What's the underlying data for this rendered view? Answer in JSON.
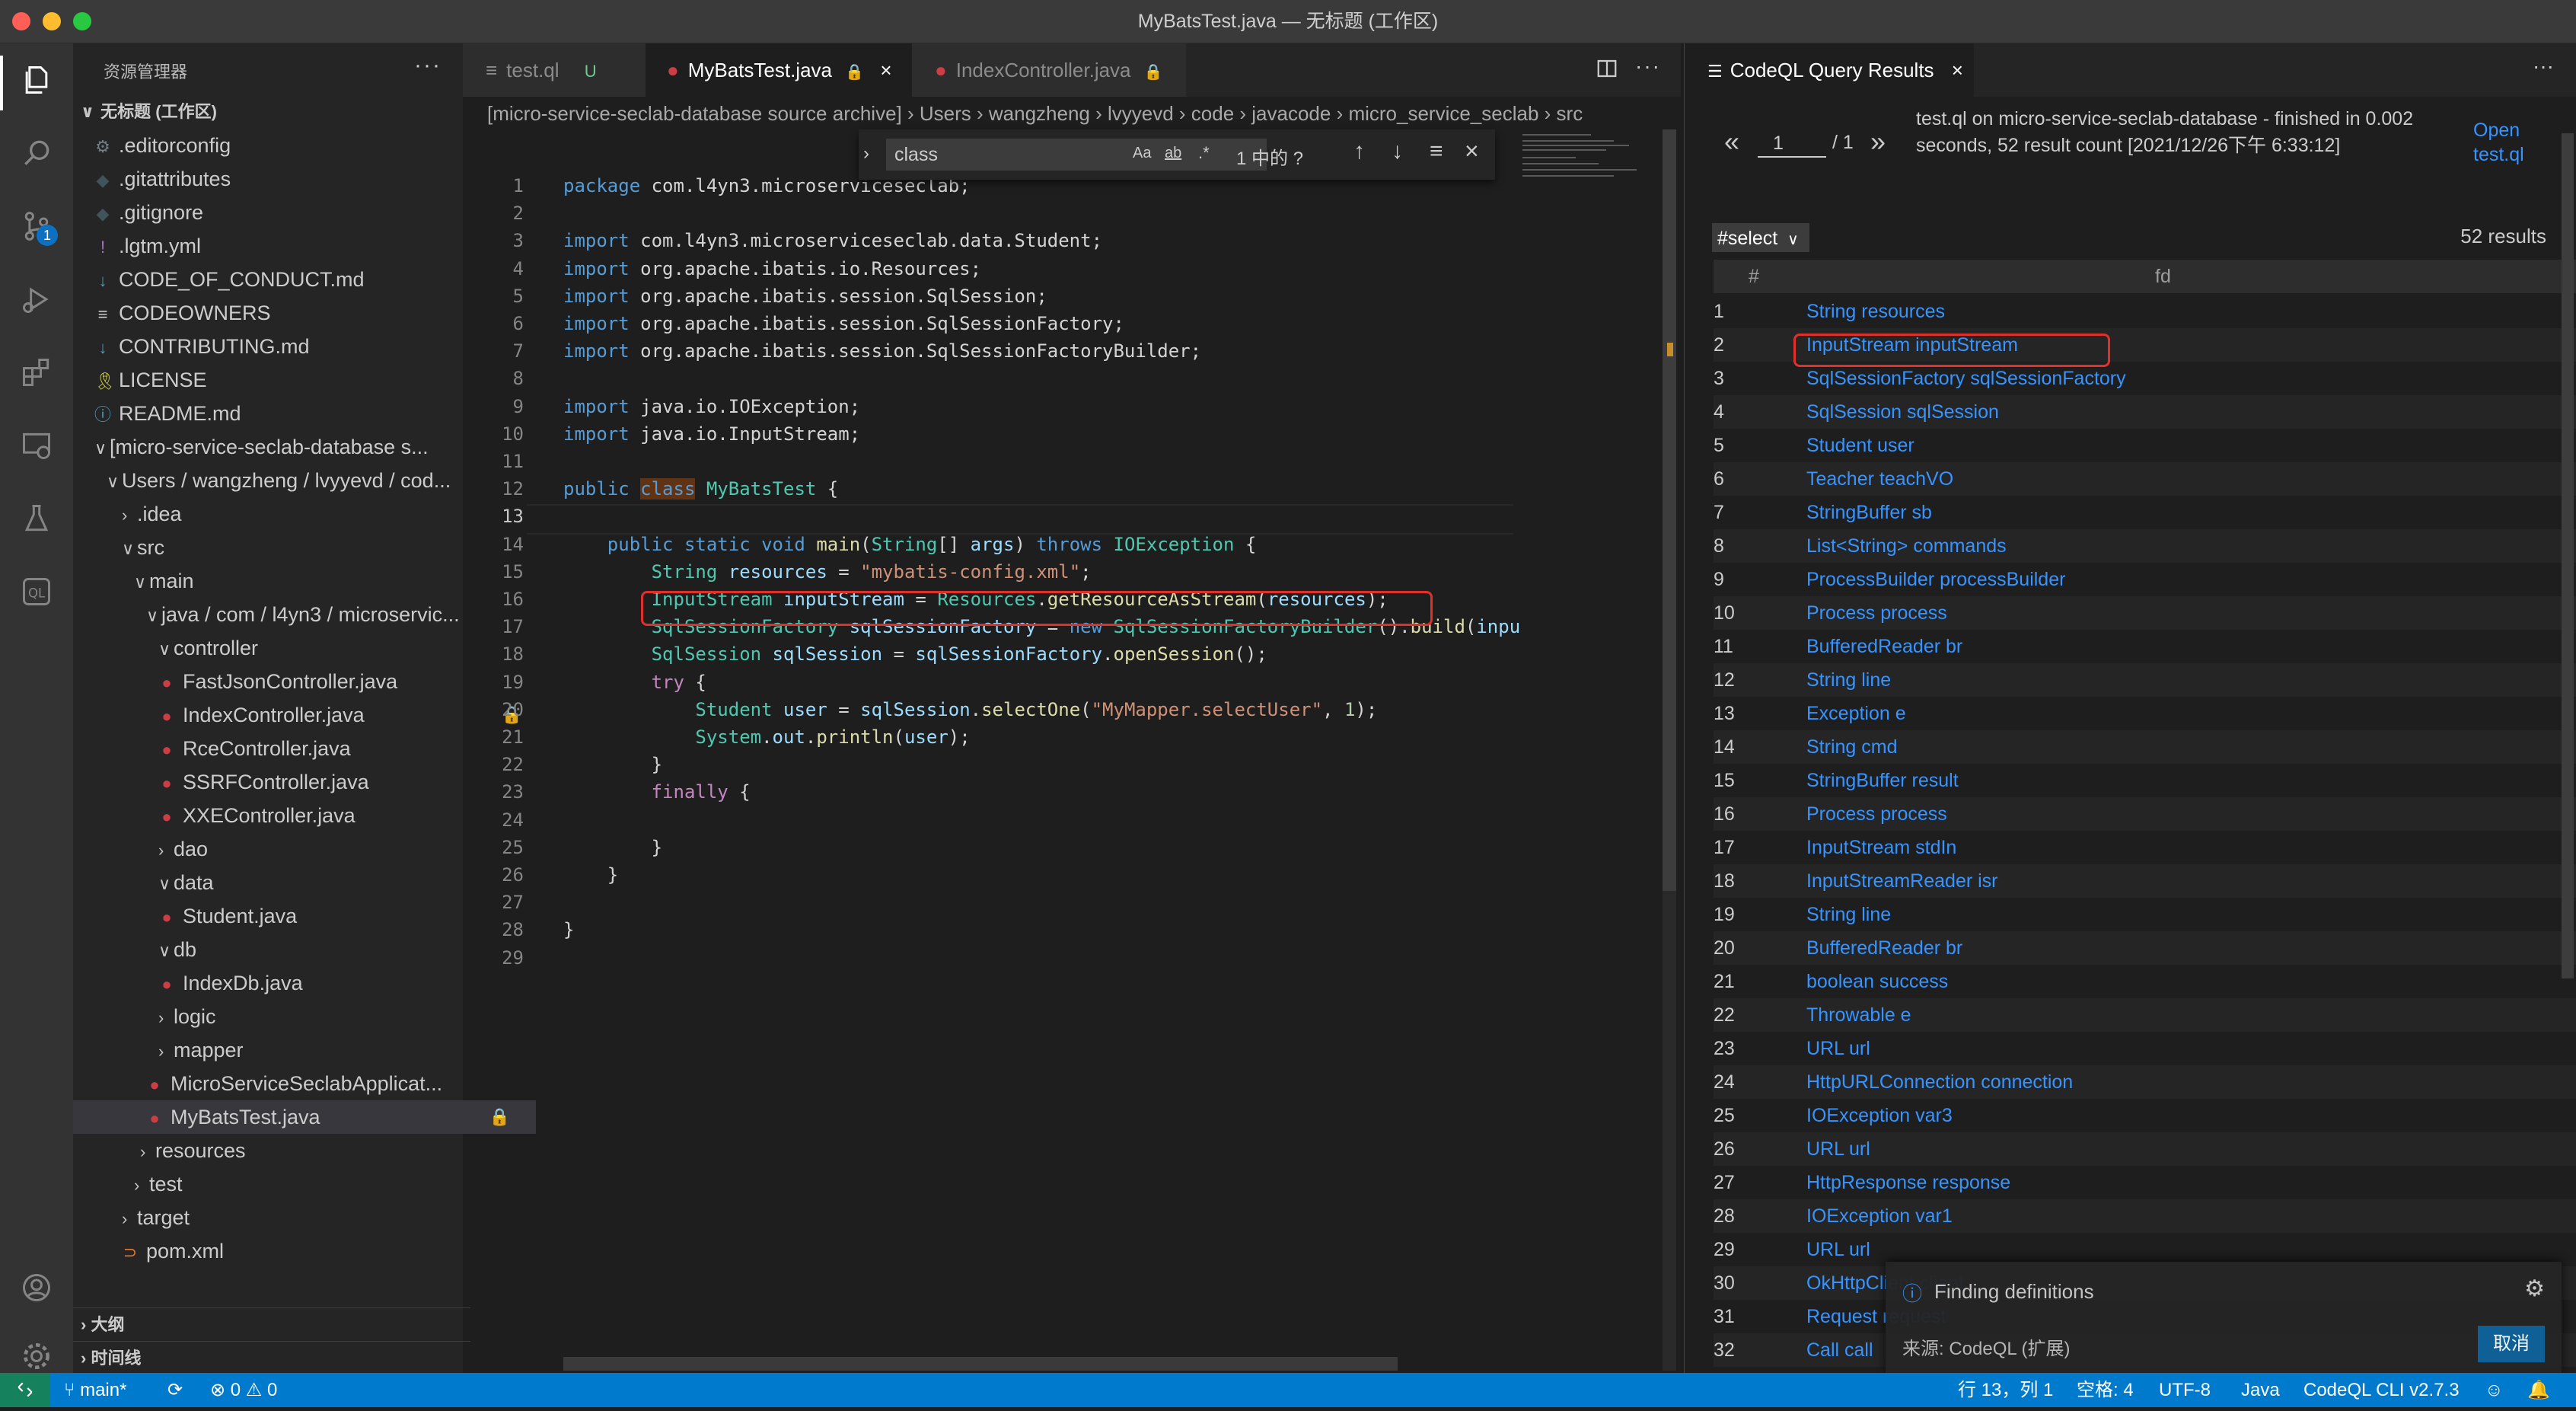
{
  "window": {
    "title": "MyBatsTest.java — 无标题 (工作区)"
  },
  "activity_bar": {
    "items": [
      "explorer-icon",
      "search-icon",
      "source-control-icon",
      "run-debug-icon",
      "extensions-icon",
      "remote-explorer-icon",
      "testing-icon",
      "codeql-icon",
      "account-icon",
      "settings-gear-icon"
    ],
    "source_control_badge": "1"
  },
  "sidebar": {
    "header": "资源管理器",
    "more": "···",
    "workspace": "无标题 (工作区)",
    "items": [
      {
        "label": ".editorconfig",
        "icon": "⚙",
        "color": "#6d8086"
      },
      {
        "label": ".gitattributes",
        "icon": "◆",
        "color": "#41535b"
      },
      {
        "label": ".gitignore",
        "icon": "◆",
        "color": "#41535b"
      },
      {
        "label": ".lgtm.yml",
        "icon": "!",
        "color": "#a074c4"
      },
      {
        "label": "CODE_OF_CONDUCT.md",
        "icon": "↓",
        "color": "#519aba"
      },
      {
        "label": "CODEOWNERS",
        "icon": "≡",
        "color": "#cccccc"
      },
      {
        "label": "CONTRIBUTING.md",
        "icon": "↓",
        "color": "#519aba"
      },
      {
        "label": "LICENSE",
        "icon": "🎗",
        "color": "#cbcb41"
      },
      {
        "label": "README.md",
        "icon": "ⓘ",
        "color": "#519aba"
      },
      {
        "label": "[micro-service-seclab-database s...",
        "chev": "∨"
      },
      {
        "label": "Users / wangzheng / lvyyevd / cod...",
        "chev": "∨"
      },
      {
        "label": ".idea",
        "chev": "›"
      },
      {
        "label": "src",
        "chev": "∨"
      },
      {
        "label": "main",
        "chev": "∨"
      },
      {
        "label": "java / com / l4yn3 / microservic...",
        "chev": "∨"
      },
      {
        "label": "controller",
        "chev": "∨"
      },
      {
        "label": "FastJsonController.java",
        "icon": "●",
        "color": "#cc3e44"
      },
      {
        "label": "IndexController.java",
        "icon": "●",
        "color": "#cc3e44",
        "lock": "🔒"
      },
      {
        "label": "RceController.java",
        "icon": "●",
        "color": "#cc3e44"
      },
      {
        "label": "SSRFController.java",
        "icon": "●",
        "color": "#cc3e44"
      },
      {
        "label": "XXEController.java",
        "icon": "●",
        "color": "#cc3e44"
      },
      {
        "label": "dao",
        "chev": "›"
      },
      {
        "label": "data",
        "chev": "∨"
      },
      {
        "label": "Student.java",
        "icon": "●",
        "color": "#cc3e44"
      },
      {
        "label": "db",
        "chev": "∨"
      },
      {
        "label": "IndexDb.java",
        "icon": "●",
        "color": "#cc3e44"
      },
      {
        "label": "logic",
        "chev": "›"
      },
      {
        "label": "mapper",
        "chev": "›"
      },
      {
        "label": "MicroServiceSeclabApplicat...",
        "icon": "●",
        "color": "#cc3e44"
      },
      {
        "label": "MyBatsTest.java",
        "icon": "●",
        "color": "#cc3e44",
        "lock": "🔒"
      },
      {
        "label": "resources",
        "chev": "›"
      },
      {
        "label": "test",
        "chev": "›"
      },
      {
        "label": "target",
        "chev": "›"
      },
      {
        "label": "pom.xml",
        "icon": "⊃",
        "color": "#e37933"
      }
    ],
    "outline": "大纲",
    "timeline": "时间线"
  },
  "editor": {
    "tabs": [
      {
        "label": "test.ql",
        "status": "U",
        "icon": "≡"
      },
      {
        "label": "MyBatsTest.java",
        "icon": "●",
        "close": "×",
        "lock": "🔒"
      },
      {
        "label": "IndexController.java",
        "icon": "●",
        "lock": "🔒"
      }
    ],
    "breadcrumbs": "[micro-service-seclab-database source archive]  ›  Users  ›  wangzheng  ›  lvyyevd  ›  code  ›  javacode  ›  micro_service_seclab  ›  src",
    "find": {
      "value": "class",
      "options": [
        "Aa",
        "ab",
        ".*"
      ],
      "result": "1 中的 ?",
      "buttons": [
        "↑",
        "↓",
        "≡",
        "×"
      ]
    },
    "current_line": 13
  },
  "results_panel": {
    "tab_label": "CodeQL Query Results",
    "page_value": "1",
    "page_total": "/ 1",
    "summary": "test.ql on micro-service-seclab-database - finished in 0.002 seconds, 52 result count [2021/12/26下午 6:33:12]",
    "open_link": "Open test.ql",
    "select_value": "#select",
    "result_count": "52 results",
    "col_num": "#",
    "col_fd": "fd",
    "rows": [
      "String resources",
      "InputStream inputStream",
      "SqlSessionFactory sqlSessionFactory",
      "SqlSession sqlSession",
      "Student user",
      "Teacher teachVO",
      "StringBuffer sb",
      "List<String> commands",
      "ProcessBuilder processBuilder",
      "Process process",
      "BufferedReader br",
      "String line",
      "Exception e",
      "String cmd",
      "StringBuffer result",
      "Process process",
      "InputStream stdIn",
      "InputStreamReader isr",
      "String line",
      "BufferedReader br",
      "boolean success",
      "Throwable e",
      "URL url",
      "HttpURLConnection connection",
      "IOException var3",
      "URL url",
      "HttpResponse response",
      "IOException var1",
      "URL url",
      "OkHttpClient client",
      "Request request",
      "Call call"
    ],
    "notification": {
      "text": "Finding definitions",
      "source": "来源: CodeQL (扩展)",
      "button": "取消"
    }
  },
  "statusbar": {
    "branch": "main*",
    "problems": "⊗ 0  ⚠ 0",
    "position": "行 13，列 1",
    "spaces": "空格: 4",
    "encoding": "UTF-8",
    "language": "Java",
    "cli": "CodeQL CLI v2.7.3"
  }
}
